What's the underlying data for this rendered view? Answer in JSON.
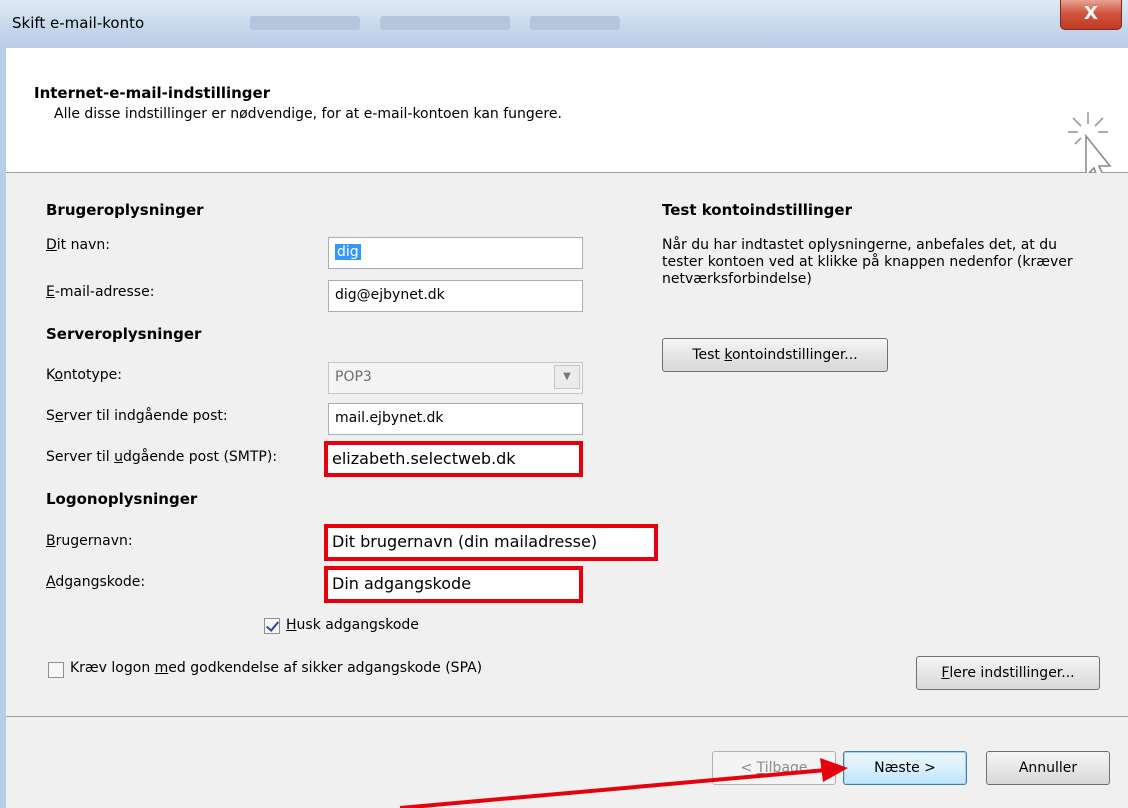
{
  "window": {
    "title": "Skift e-mail-konto",
    "close_label": "X"
  },
  "header": {
    "title": "Internet-e-mail-indstillinger",
    "subtitle": "Alle disse indstillinger er nødvendige, for at e-mail-kontoen kan fungere."
  },
  "user_info": {
    "heading": "Brugeroplysninger",
    "name_label_u": "D",
    "name_label_rest": "it navn:",
    "name_value": "dig",
    "email_label_u": "E",
    "email_label_rest": "-mail-adresse:",
    "email_value": "dig@ejbynet.dk"
  },
  "server_info": {
    "heading": "Serveroplysninger",
    "account_type_label_pre": "K",
    "account_type_label_u": "o",
    "account_type_label_rest": "ntotype:",
    "account_type_value": "POP3",
    "incoming_label_pre": "S",
    "incoming_label_u": "e",
    "incoming_label_rest": "rver til indgående post:",
    "incoming_value": "mail.ejbynet.dk",
    "outgoing_label_pre": "Server til ",
    "outgoing_label_u": "u",
    "outgoing_label_rest": "dgående post (SMTP):",
    "outgoing_value": "elizabeth.selectweb.dk"
  },
  "logon_info": {
    "heading": "Logonoplysninger",
    "username_label_u": "B",
    "username_label_rest": "rugernavn:",
    "username_value": "Dit brugernavn (din mailadresse)",
    "password_label_u": "A",
    "password_label_rest": "dgangskode:",
    "password_value": "Din adgangskode",
    "remember_label_u": "H",
    "remember_label_rest": "usk adgangskode",
    "remember_checked": true,
    "spa_label_pre": "Kræv logon ",
    "spa_label_u": "m",
    "spa_label_rest": "ed godkendelse af sikker adgangskode (SPA)",
    "spa_checked": false
  },
  "test": {
    "heading": "Test kontoindstillinger",
    "description": "Når du har indtastet oplysningerne, anbefales det, at du tester kontoen ved at klikke på knappen nedenfor (kræver netværksforbindelse)",
    "button_pre": "Test ",
    "button_u": "k",
    "button_rest": "ontoindstillinger..."
  },
  "more_settings": {
    "u": "F",
    "rest": "lere indstillinger..."
  },
  "footer": {
    "back_pre": "< ",
    "back_u": "T",
    "back_rest": "ilbage",
    "next_label": "Næste >",
    "cancel_label": "Annuller"
  },
  "colors": {
    "highlight_border": "#e8000d",
    "arrow": "#e8000d",
    "dialog_background": "#f0f0f0"
  }
}
